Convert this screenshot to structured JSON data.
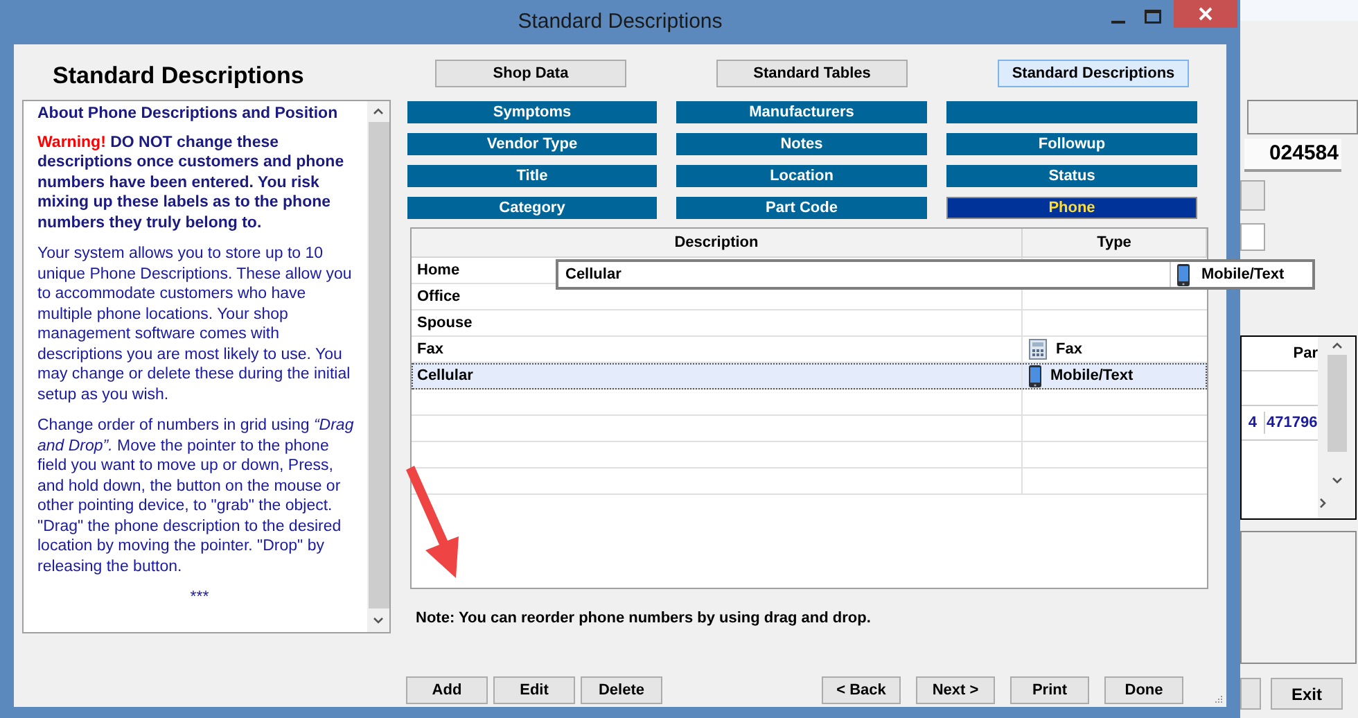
{
  "window": {
    "title": "Standard Descriptions"
  },
  "heading": "Standard Descriptions",
  "help": {
    "title": "About Phone Descriptions and Position",
    "warning": {
      "label": "Warning!",
      "text": "DO NOT change these descriptions once customers and phone numbers have been entered. You risk mixing up these labels as to the phone numbers they truly belong to."
    },
    "paragraphs": [
      "Your system allows you to store up to 10 unique Phone Descriptions. These allow you to accommodate customers who have multiple phone locations.  Your shop management software comes with descriptions you are most likely to use. You may change or delete these during the initial setup as you wish.",
      "Change order of numbers in grid using *“Drag and Drop”.*  Move the pointer to the phone field you want to move up or down, Press, and hold down, the button on the mouse or other pointing device, to \"grab\" the object. \"Drag\" the phone description to the desired location by moving the pointer. \"Drop\" by releasing the button."
    ],
    "end_mark": "***"
  },
  "nav_buttons": [
    {
      "label": "Shop Data",
      "selected": false
    },
    {
      "label": "Standard Tables",
      "selected": false
    },
    {
      "label": "Standard Descriptions",
      "selected": true
    }
  ],
  "categories": [
    {
      "label": "Symptoms",
      "selected": false
    },
    {
      "label": "Manufacturers",
      "selected": false
    },
    {
      "selected": false
    },
    {
      "label": "Vendor Type",
      "selected": false
    },
    {
      "label": "Notes",
      "selected": false
    },
    {
      "label": "Followup",
      "selected": false
    },
    {
      "label": "Title",
      "selected": false
    },
    {
      "label": "Location",
      "selected": false
    },
    {
      "label": "Status",
      "selected": false
    },
    {
      "label": "Category",
      "selected": false
    },
    {
      "label": "Part Code",
      "selected": false
    },
    {
      "label": "Phone",
      "selected": true
    }
  ],
  "table": {
    "columns": [
      "Description",
      "Type"
    ],
    "rows": [
      {
        "description": "Home",
        "selected": false
      },
      {
        "description": "Office",
        "selected": false
      },
      {
        "description": "Spouse",
        "selected": false
      },
      {
        "description": "Fax",
        "type": "Fax",
        "kind": "fax",
        "selected": false
      },
      {
        "description": "Cellular",
        "type": "Mobile/Text",
        "kind": "mobile",
        "selected": true
      }
    ]
  },
  "drag_row": {
    "description": "Cellular",
    "type": "Mobile/Text",
    "kind": "mobile"
  },
  "note": "Note: You can reorder phone numbers by using drag and drop.",
  "buttons_left": [
    "Add",
    "Edit",
    "Delete"
  ],
  "buttons_right": [
    "< Back",
    "Next >",
    "Print",
    "Done"
  ],
  "background": {
    "number": "024584",
    "grid_header": "Par",
    "cell_fragment": "4",
    "cell_value": "471796",
    "exit_button": "Exit"
  }
}
